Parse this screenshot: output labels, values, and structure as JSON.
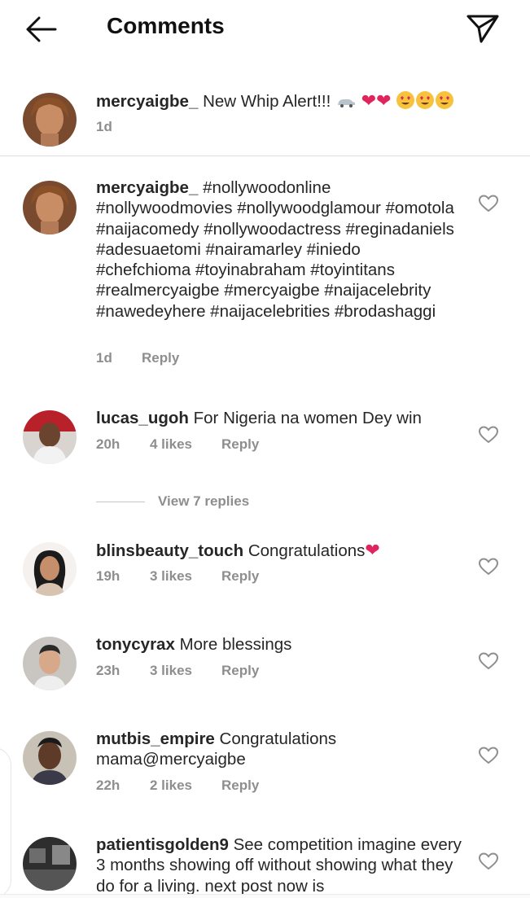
{
  "header": {
    "title": "Comments",
    "back_icon": "arrow-left-icon",
    "share_icon": "paper-plane-icon"
  },
  "caption": {
    "username": "mercyaigbe_",
    "text": "New Whip Alert!!!",
    "emoji": "car, red hearts x2, heart-eyes x3",
    "time": "1d"
  },
  "comments": [
    {
      "username": "mercyaigbe_",
      "text": "#nollywoodonline #nollywoodmovies #nollywoodglamour #omotola #naijacomedy #nollywoodactress #reginadaniels #adesuaetomi #nairamarley #iniedo #chefchioma #toyinabraham #toyintitans #realmercyaigbe #mercyaigbe #naijacelebrity #nawedeyhere #naijacelebrities #brodashaggi",
      "time": "1d",
      "likes": "",
      "reply": "Reply"
    },
    {
      "username": "lucas_ugoh",
      "text": "For Nigeria na women Dey win",
      "time": "20h",
      "likes": "4 likes",
      "reply": "Reply",
      "view_replies": "View 7 replies"
    },
    {
      "username": "blinsbeauty_touch",
      "text": "Congratulations",
      "time": "19h",
      "likes": "3 likes",
      "reply": "Reply"
    },
    {
      "username": "tonycyrax",
      "text": "More blessings",
      "time": "23h",
      "likes": "3 likes",
      "reply": "Reply"
    },
    {
      "username": "mutbis_empire",
      "text": "Congratulations mama@mercyaigbe",
      "time": "22h",
      "likes": "2 likes",
      "reply": "Reply"
    },
    {
      "username": "patientisgolden9",
      "text": "See competition imagine every 3 months showing off without showing what they do for a living. next post now is",
      "time": "",
      "likes": "",
      "reply": ""
    }
  ],
  "colors": {
    "text": "#262626",
    "meta": "#8e8e8e",
    "heart_red": "#e0245e",
    "divider": "#dbdbdb"
  }
}
